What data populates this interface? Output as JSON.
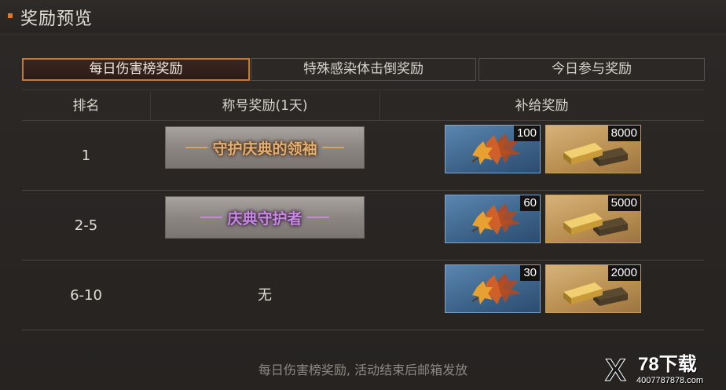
{
  "header": {
    "title": "奖励预览"
  },
  "tabs": [
    {
      "label": "每日伤害榜奖励",
      "active": true
    },
    {
      "label": "特殊感染体击倒奖励",
      "active": false
    },
    {
      "label": "今日参与奖励",
      "active": false
    }
  ],
  "table": {
    "headers": {
      "rank": "排名",
      "title": "称号奖励(1天)",
      "supply": "补给奖励"
    },
    "rows": [
      {
        "rank": "1",
        "title": "守护庆典的领袖",
        "title_style": "gold",
        "leaf_qty": "100",
        "gold_qty": "8000"
      },
      {
        "rank": "2-5",
        "title": "庆典守护者",
        "title_style": "purple",
        "leaf_qty": "60",
        "gold_qty": "5000"
      },
      {
        "rank": "6-10",
        "title": "无",
        "title_style": "none",
        "leaf_qty": "30",
        "gold_qty": "2000"
      }
    ]
  },
  "items": {
    "leaf_icon": "maple-leaf-icon",
    "gold_icon": "gold-bar-icon"
  },
  "footer": {
    "note": "每日伤害榜奖励, 活动结束后邮箱发放"
  },
  "watermark": {
    "mark": "X",
    "brand": "78下载",
    "url": "4007787878.com"
  },
  "colors": {
    "accent": "#c07a3a",
    "leaf_bg": "#3c6288",
    "gold_bg": "#b88e50",
    "gold_title": "#e0b074",
    "purple_title": "#c58ae0"
  }
}
